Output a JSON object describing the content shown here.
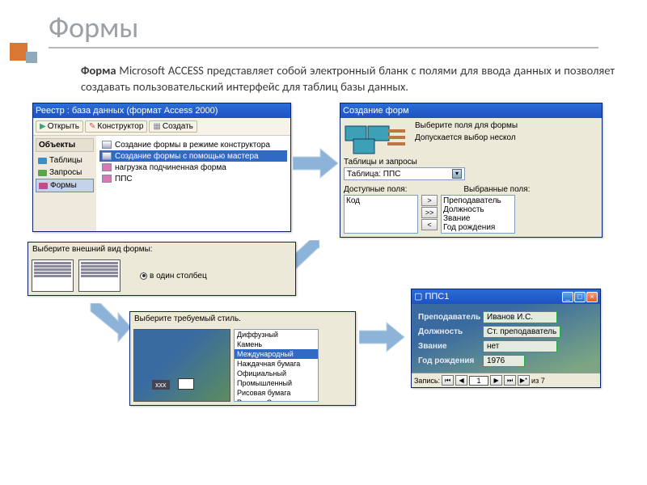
{
  "slide": {
    "title": "Формы"
  },
  "definition": {
    "bold": "Форма",
    "rest": " Microsoft ACCESS представляет собой электронный бланк с полями для ввода данных и позволяет создавать пользовательский интерфейс для таблиц базы данных."
  },
  "dbwin": {
    "title": "Реестр : база данных (формат Access 2000)",
    "toolbar": {
      "open": "Открыть",
      "design": "Конструктор",
      "create": "Создать"
    },
    "objects_header": "Объекты",
    "objects": {
      "tables": "Таблицы",
      "queries": "Запросы",
      "forms": "Формы"
    },
    "list": {
      "i1": "Создание формы в режиме конструктора",
      "i2": "Создание формы с помощью мастера",
      "i3": "нагрузка подчиненная форма",
      "i4": "ППС"
    }
  },
  "wiz": {
    "title": "Создание форм",
    "hint1": "Выберите поля для формы",
    "hint2": "Допускается выбор нескол",
    "tables_label": "Таблицы и запросы",
    "table_value": "Таблица: ППС",
    "avail_label": "Доступные поля:",
    "sel_label": "Выбранные поля:",
    "avail": {
      "a1": "Код"
    },
    "sel": {
      "s1": "Преподаватель",
      "s2": "Должность",
      "s3": "Звание",
      "s4": "Год рождения"
    },
    "buttons": {
      "b1": ">",
      "b2": ">>",
      "b3": "<"
    }
  },
  "layout": {
    "title": "Выберите внешний вид формы:",
    "option": "в один столбец"
  },
  "style": {
    "title": "Выберите требуемый стиль.",
    "preview_label": "xxx",
    "list": {
      "l1": "Диффузный",
      "l2": "Камень",
      "l3": "Международный",
      "l4": "Наждачная бумага",
      "l5": "Официальный",
      "l6": "Промышленный",
      "l7": "Рисовая бумага",
      "l8": "Рисунок Суми"
    }
  },
  "form": {
    "title": "ППС1",
    "fields": {
      "teacher_l": "Преподаватель",
      "teacher_v": "Иванов И.С.",
      "post_l": "Должность",
      "post_v": "Ст. преподаватель",
      "rank_l": "Звание",
      "rank_v": "нет",
      "year_l": "Год рождения",
      "year_v": "1976"
    },
    "nav": {
      "label": "Запись:",
      "pos": "1",
      "of": "из 7"
    }
  }
}
